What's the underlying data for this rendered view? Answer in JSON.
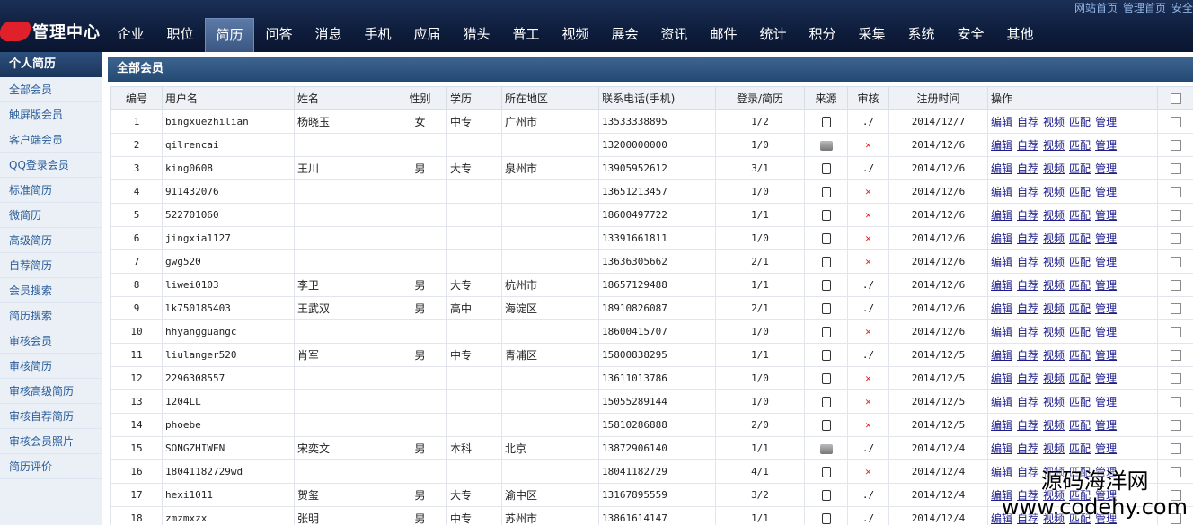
{
  "header": {
    "logo_text": "管理中心",
    "top_links": [
      "网站首页",
      "管理首页",
      "安全"
    ],
    "nav": [
      "企业",
      "职位",
      "简历",
      "问答",
      "消息",
      "手机",
      "应届",
      "猎头",
      "普工",
      "视频",
      "展会",
      "资讯",
      "邮件",
      "统计",
      "积分",
      "采集",
      "系统",
      "安全",
      "其他"
    ],
    "active_nav": "简历"
  },
  "sidebar": {
    "title": "个人简历",
    "items": [
      "全部会员",
      "触屏版会员",
      "客户端会员",
      "QQ登录会员",
      "标准简历",
      "微简历",
      "高级简历",
      "自荐简历",
      "会员搜索",
      "简历搜索",
      "审核会员",
      "审核简历",
      "审核高级简历",
      "审核自荐简历",
      "审核会员照片",
      "简历评价"
    ]
  },
  "panel": {
    "title": "全部会员"
  },
  "table": {
    "columns": [
      "编号",
      "用户名",
      "姓名",
      "性别",
      "学历",
      "所在地区",
      "联系电话(手机)",
      "登录/简历",
      "来源",
      "审核",
      "注册时间",
      "操作",
      ""
    ],
    "ops": [
      "编辑",
      "自荐",
      "视频",
      "匹配",
      "管理"
    ],
    "rows": [
      [
        "1",
        "bingxuezhilian",
        "杨晓玉",
        "女",
        "中专",
        "广州市",
        "13533338895",
        "1/2",
        "phone",
        "ok",
        "2014/12/7"
      ],
      [
        "2",
        "qilrencai",
        "",
        "",
        "",
        "",
        "13200000000",
        "1/0",
        "pc",
        "no",
        "2014/12/6"
      ],
      [
        "3",
        "king0608",
        "王川",
        "男",
        "大专",
        "泉州市",
        "13905952612",
        "3/1",
        "phone",
        "ok",
        "2014/12/6"
      ],
      [
        "4",
        "911432076",
        "",
        "",
        "",
        "",
        "13651213457",
        "1/0",
        "phone",
        "no",
        "2014/12/6"
      ],
      [
        "5",
        "522701060",
        "",
        "",
        "",
        "",
        "18600497722",
        "1/1",
        "phone",
        "no",
        "2014/12/6"
      ],
      [
        "6",
        "jingxia1127",
        "",
        "",
        "",
        "",
        "13391661811",
        "1/0",
        "phone",
        "no",
        "2014/12/6"
      ],
      [
        "7",
        "gwg520",
        "",
        "",
        "",
        "",
        "13636305662",
        "2/1",
        "phone",
        "no",
        "2014/12/6"
      ],
      [
        "8",
        "liwei0103",
        "李卫",
        "男",
        "大专",
        "杭州市",
        "18657129488",
        "1/1",
        "phone",
        "ok",
        "2014/12/6"
      ],
      [
        "9",
        "lk750185403",
        "王武双",
        "男",
        "高中",
        "海淀区",
        "18910826087",
        "2/1",
        "phone",
        "ok",
        "2014/12/6"
      ],
      [
        "10",
        "hhyangguangc",
        "",
        "",
        "",
        "",
        "18600415707",
        "1/0",
        "phone",
        "no",
        "2014/12/6"
      ],
      [
        "11",
        "liulanger520",
        "肖军",
        "男",
        "中专",
        "青浦区",
        "15800838295",
        "1/1",
        "phone",
        "ok",
        "2014/12/5"
      ],
      [
        "12",
        "2296308557",
        "",
        "",
        "",
        "",
        "13611013786",
        "1/0",
        "phone",
        "no",
        "2014/12/5"
      ],
      [
        "13",
        "1204LL",
        "",
        "",
        "",
        "",
        "15055289144",
        "1/0",
        "phone",
        "no",
        "2014/12/5"
      ],
      [
        "14",
        "phoebe",
        "",
        "",
        "",
        "",
        "15810286888",
        "2/0",
        "phone",
        "no",
        "2014/12/5"
      ],
      [
        "15",
        "SONGZHIWEN",
        "宋奕文",
        "男",
        "本科",
        "北京",
        "13872906140",
        "1/1",
        "pc",
        "ok",
        "2014/12/4"
      ],
      [
        "16",
        "18041182729wd",
        "",
        "",
        "",
        "",
        "18041182729",
        "4/1",
        "phone",
        "no",
        "2014/12/4"
      ],
      [
        "17",
        "hexi1011",
        "贺玺",
        "男",
        "大专",
        "渝中区",
        "13167895559",
        "3/2",
        "phone",
        "ok",
        "2014/12/4"
      ],
      [
        "18",
        "zmzmxzx",
        "张明",
        "男",
        "中专",
        "苏州市",
        "13861614147",
        "1/1",
        "phone",
        "ok",
        "2014/12/4"
      ]
    ]
  },
  "status_symbols": {
    "ok": "./",
    "no": "✕"
  },
  "watermark": {
    "line1": "源码海洋网",
    "line2": "www.codehy.com"
  }
}
